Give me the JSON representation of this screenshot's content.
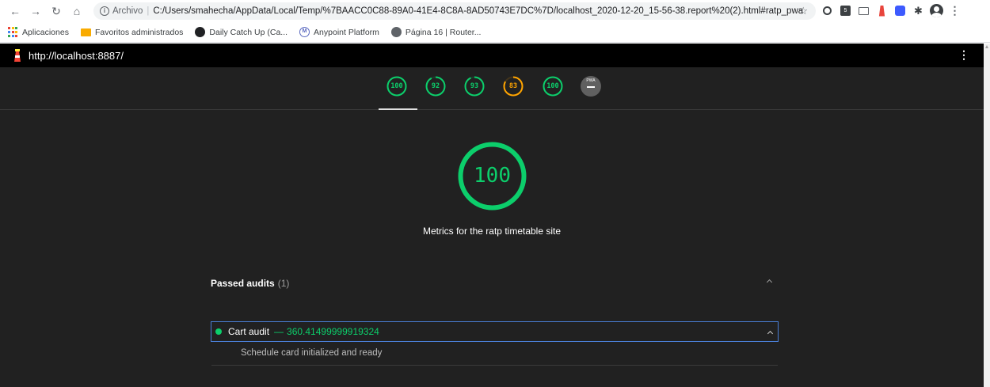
{
  "browser": {
    "url_scheme_label": "Archivo",
    "url_separator": "|",
    "url_path": "C:/Users/smahecha/AppData/Local/Temp/%7BAACC0C88-89A0-41E4-8C8A-8AD50743E7DC%7D/localhost_2020-12-20_15-56-38.report%20(2).html#ratp_pwa",
    "icons": [
      "back-icon",
      "forward-icon",
      "reload-icon",
      "home-icon",
      "info-icon",
      "star-icon"
    ]
  },
  "bookmarks": [
    {
      "label": "Aplicaciones",
      "icon": "apps-grid-icon"
    },
    {
      "label": "Favoritos administrados",
      "icon": "folder-icon"
    },
    {
      "label": "Daily Catch Up (Ca...",
      "icon": "circle-icon"
    },
    {
      "label": "Anypoint Platform",
      "icon": "mulesoft-icon"
    },
    {
      "label": "Página 16 | Router...",
      "icon": "globe-icon"
    }
  ],
  "report": {
    "topbar_url": "http://localhost:8887/",
    "gauges": [
      {
        "value": "100",
        "fraction": 1.0,
        "color": "#0cce6b"
      },
      {
        "value": "92",
        "fraction": 0.92,
        "color": "#0cce6b"
      },
      {
        "value": "93",
        "fraction": 0.93,
        "color": "#0cce6b"
      },
      {
        "value": "83",
        "fraction": 0.83,
        "color": "#ffa400"
      },
      {
        "value": "100",
        "fraction": 1.0,
        "color": "#0cce6b"
      }
    ],
    "pwa_label": "PWA",
    "main_score": {
      "value": "100",
      "fraction": 1.0,
      "color": "#0cce6b"
    },
    "category_description": "Metrics for the ratp timetable site",
    "passed_audits_title": "Passed audits",
    "passed_audits_count": "(1)",
    "audit": {
      "title": "Cart audit",
      "dash": "—",
      "metric": "360.41499999919324",
      "description": "Schedule card initialized and ready"
    }
  },
  "colors": {
    "pass": "#0cce6b",
    "average": "#ffa400",
    "page_bg": "#212121",
    "topbar_bg": "#000000"
  }
}
